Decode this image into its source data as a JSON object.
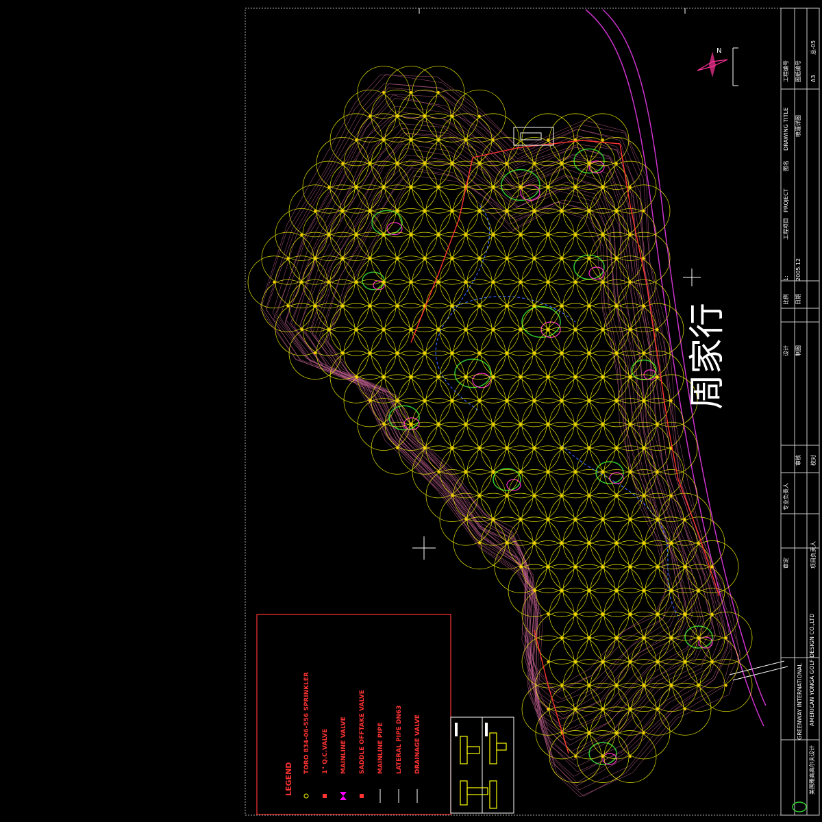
{
  "drawing": {
    "road_label": "周家行",
    "north_label": "N"
  },
  "legend": {
    "title": "LEGEND",
    "items": [
      {
        "symbol": "sprinkler-circle-icon",
        "label": "TORO 834-06-556 SPRINKLER",
        "color": "#ffff00"
      },
      {
        "symbol": "qc-valve-icon",
        "label": "1\" Q.C.VALVE",
        "color": "#ff3333"
      },
      {
        "symbol": "mainline-valve-icon",
        "label": "MAINLINE VALVE",
        "color": "#ff00ff"
      },
      {
        "symbol": "saddle-valve-icon",
        "label": "SADDLE OFFTAKE VALVE",
        "color": "#ff3333"
      },
      {
        "symbol": "mainline-pipe-icon",
        "label": "MAINLINE PIPE",
        "color": "#ff3333"
      },
      {
        "symbol": "lateral-pipe-icon",
        "label": "LATERAL PIPE DN63",
        "color": "#ff3333"
      },
      {
        "symbol": "drainage-valve-icon",
        "label": "DRAINAGE VALVE",
        "color": "#ff3333"
      }
    ]
  },
  "title_block": {
    "company_cn": "美国雅高高尔夫设计",
    "company_en": "AMERICAN YONGA GOLF DESIGN CO.,LTD",
    "intl": "GREENWAY INTERNATIONAL",
    "project_label": "工程项目",
    "project_en": "PROJECT",
    "drawing_name_label": "图名",
    "drawing_title_en": "DRAWING TITLE",
    "drawing_title_cn": "喷灌详图",
    "date_label": "日期",
    "date_value": "2005.12",
    "scale_label": "比例",
    "scale_value": "1:",
    "drawing_no_label": "工程编号",
    "drawing_no_value": "总-05",
    "sheet_label": "图纸编号",
    "sheet_value": "A3",
    "design_label": "设计",
    "draw_label": "制图",
    "check_label": "审核",
    "approve_label": "审定",
    "review_label": "校对",
    "manager_label": "项目负责人",
    "professional_label": "专业负责人"
  },
  "colors": {
    "background": "#000000",
    "sprinkler": "#ffff00",
    "contour": "#c06090",
    "green_outline": "#33cc33",
    "hazard": "#ff33cc",
    "pipe": "#ff3333",
    "drain": "#3366ff",
    "road": "#cc33cc",
    "frame": "#cccccc"
  }
}
